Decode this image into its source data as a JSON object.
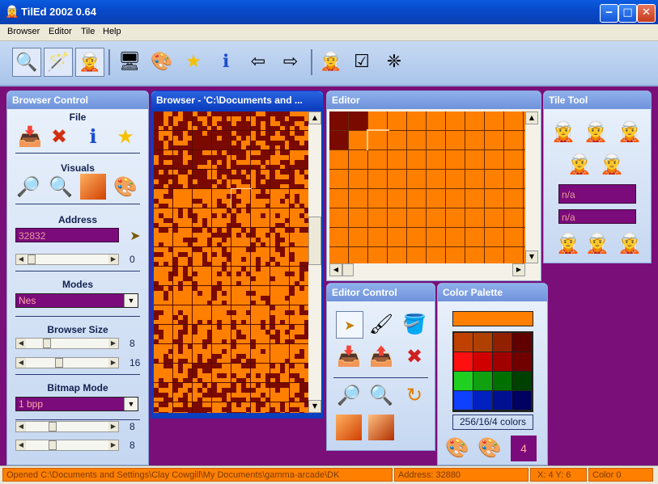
{
  "title": "TilEd 2002 0.64",
  "menu": [
    "Browser",
    "Editor",
    "Tile",
    "Help"
  ],
  "browser_control": {
    "title": "Browser Control",
    "file_label": "File",
    "visuals_label": "Visuals",
    "address_label": "Address",
    "address_value": "32832",
    "address_slider_value": "0",
    "modes_label": "Modes",
    "mode_value": "Nes",
    "browser_size_label": "Browser Size",
    "size_values": [
      "8",
      "16"
    ],
    "bitmap_mode_label": "Bitmap Mode",
    "bitmap_mode_value": "1 bpp",
    "bitmap_values": [
      "8",
      "8"
    ]
  },
  "browser": {
    "title": "Browser - 'C:\\Documents and ..."
  },
  "editor": {
    "title": "Editor"
  },
  "editor_control": {
    "title": "Editor Control"
  },
  "tile_tool": {
    "title": "Tile Tool",
    "field1": "n/a",
    "field2": "n/a"
  },
  "color_palette": {
    "title": "Color Palette",
    "colors_label": "256/16/4 colors",
    "palette_index": "4"
  },
  "status": {
    "message": "Opened C:\\Documents and Settings\\Clay Cowgill\\My Documents\\gamma-arcade\\DK",
    "address": "Address: 32880",
    "xy": "X: 4   Y: 6",
    "color": "Color 0"
  },
  "colors": {
    "orange": "#ff7f00",
    "dark_red": "#7a0a00",
    "purple": "#7a0f7a"
  },
  "palette": [
    [
      "#c04000",
      "#b04000",
      "#902000",
      "#600000"
    ],
    [
      "#ff1010",
      "#d00000",
      "#a00000",
      "#700000"
    ],
    [
      "#20d020",
      "#10a010",
      "#007000",
      "#004000"
    ],
    [
      "#1040ff",
      "#0020c0",
      "#001090",
      "#000060"
    ]
  ]
}
